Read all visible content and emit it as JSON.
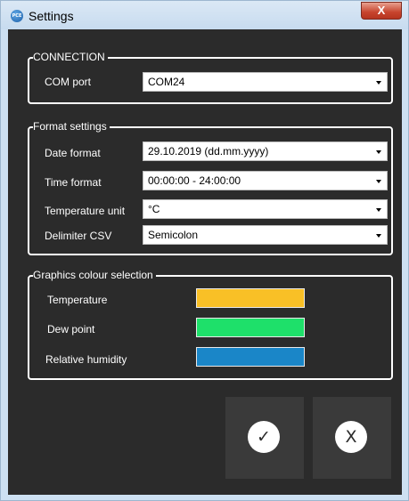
{
  "window": {
    "title": "Settings",
    "close_glyph": "X",
    "app_icon_text": "PCE"
  },
  "connection": {
    "legend": "CONNECTION",
    "com_port": {
      "label": "COM port",
      "value": "COM24"
    }
  },
  "format": {
    "legend": "Format settings",
    "date": {
      "label": "Date format",
      "value": "29.10.2019 (dd.mm.yyyy)"
    },
    "time": {
      "label": "Time format",
      "value": "00:00:00 - 24:00:00"
    },
    "temperature_unit": {
      "label": "Temperature unit",
      "value": "°C"
    },
    "delimiter": {
      "label": "Delimiter CSV",
      "value": "Semicolon"
    }
  },
  "graphics": {
    "legend": "Graphics colour selection",
    "temperature": {
      "label": "Temperature",
      "color": "#f9c026"
    },
    "dew_point": {
      "label": "Dew point",
      "color": "#1ee06a"
    },
    "humidity": {
      "label": "Relative humidity",
      "color": "#1a86c8"
    }
  },
  "actions": {
    "ok_glyph": "✓",
    "cancel_glyph": "X"
  }
}
